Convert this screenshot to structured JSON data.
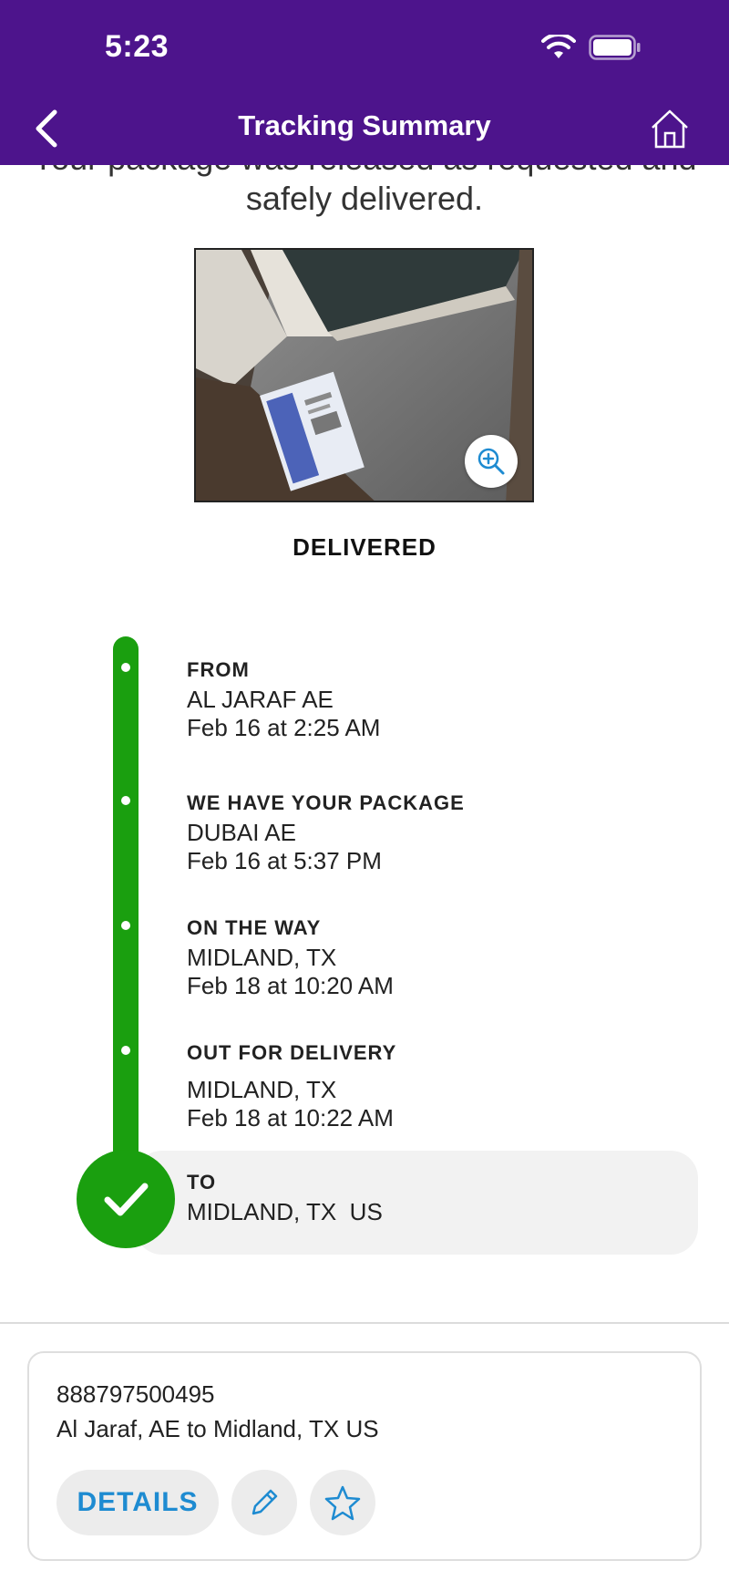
{
  "status_bar": {
    "time": "5:23"
  },
  "nav": {
    "title": "Tracking Summary",
    "back_icon": "chevron-left-icon",
    "home_icon": "home-icon"
  },
  "intro_lines": [
    "Your package was released as requested and",
    "safely delivered."
  ],
  "photo": {
    "zoom_icon": "zoom-in-icon"
  },
  "status": "DELIVERED",
  "timeline": [
    {
      "title": "FROM",
      "location": "AL JARAF AE",
      "time": "Feb 16 at 2:25 AM"
    },
    {
      "title": "WE HAVE YOUR PACKAGE",
      "location": "DUBAI AE",
      "time": "Feb 16 at 5:37 PM"
    },
    {
      "title": "ON THE WAY",
      "location": "MIDLAND, TX",
      "time": "Feb 18 at 10:20 AM"
    },
    {
      "title": "OUT FOR DELIVERY",
      "location": "MIDLAND, TX",
      "time": "Feb 18 at 10:22 AM"
    },
    {
      "title": "TO",
      "location": "MIDLAND, TX  US"
    }
  ],
  "card": {
    "tracking_number": "888797500495",
    "route": "Al Jaraf, AE to Midland, TX US",
    "details_label": "DETAILS",
    "edit_icon": "pencil-icon",
    "favorite_icon": "star-icon"
  },
  "colors": {
    "brand_purple": "#4d148c",
    "success_green": "#1a9f0f",
    "link_blue": "#1e8bd1"
  }
}
